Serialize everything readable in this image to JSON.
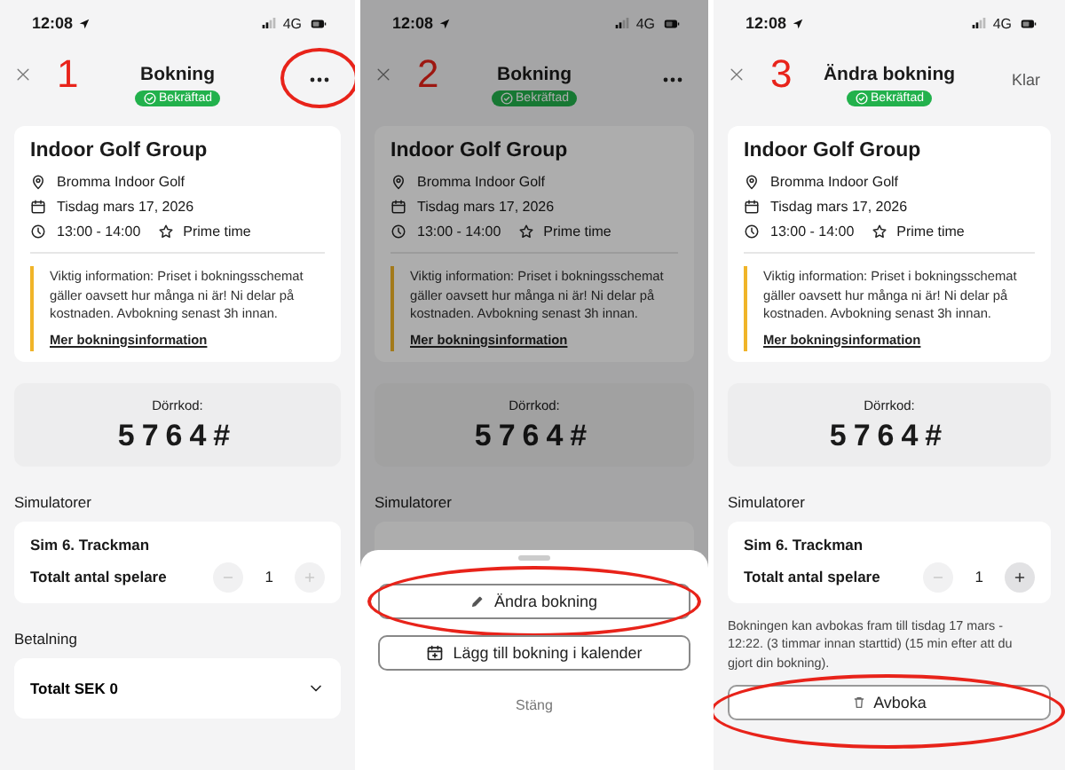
{
  "panels": [
    {
      "status_bar": {
        "time": "12:08",
        "network": "4G"
      },
      "step": "1",
      "dimmed": false,
      "header": {
        "title": "Bokning",
        "badge": "Bekräftad",
        "action": {
          "kind": "menu",
          "circled": true
        }
      },
      "booking": {
        "title": "Indoor Golf Group",
        "location": "Bromma Indoor Golf",
        "date": "Tisdag mars 17, 2026",
        "time": "13:00 - 14:00",
        "tag": "Prime time",
        "info": "Viktig information: Priset i bokningsschemat gäller oavsett hur många ni är! Ni delar på kostnaden. Avbokning senast 3h innan.",
        "link": "Mer bokningsinformation"
      },
      "door_code": {
        "label": "Dörrkod:",
        "code": "5764#"
      },
      "simulators": {
        "heading": "Simulatorer",
        "card": {
          "name": "Sim 6. Trackman",
          "players_label": "Totalt antal spelare",
          "count": "1",
          "minus_disabled": true,
          "plus_disabled": true
        }
      },
      "payment": {
        "heading": "Betalning",
        "total": "Totalt SEK 0",
        "expanded": false
      }
    },
    {
      "status_bar": {
        "time": "12:08",
        "network": "4G"
      },
      "step": "2",
      "dimmed": true,
      "header": {
        "title": "Bokning",
        "badge": "Bekräftad",
        "action": {
          "kind": "menu",
          "circled": false
        }
      },
      "booking": {
        "title": "Indoor Golf Group",
        "location": "Bromma Indoor Golf",
        "date": "Tisdag mars 17, 2026",
        "time": "13:00 - 14:00",
        "tag": "Prime time",
        "info": "Viktig information: Priset i bokningsschemat gäller oavsett hur många ni är! Ni delar på kostnaden. Avbokning senast 3h innan.",
        "link": "Mer bokningsinformation"
      },
      "door_code": {
        "label": "Dörrkod:",
        "code": "5764#"
      },
      "simulators": {
        "heading": "Simulatorer"
      },
      "sheet": {
        "actions": [
          {
            "kind": "edit",
            "label": "Ändra bokning",
            "circled": true
          },
          {
            "kind": "calendar",
            "label": "Lägg till bokning i kalender",
            "circled": false
          },
          {
            "kind": "close",
            "label": "Stäng",
            "circled": false
          }
        ]
      }
    },
    {
      "status_bar": {
        "time": "12:08",
        "network": "4G"
      },
      "step": "3",
      "dimmed": false,
      "header": {
        "title": "Ändra bokning",
        "badge": "Bekräftad",
        "action": {
          "kind": "text",
          "label": "Klar",
          "circled": false
        }
      },
      "booking": {
        "title": "Indoor Golf Group",
        "location": "Bromma Indoor Golf",
        "date": "Tisdag mars 17, 2026",
        "time": "13:00 - 14:00",
        "tag": "Prime time",
        "info": "Viktig information: Priset i bokningsschemat gäller oavsett hur många ni är! Ni delar på kostnaden. Avbokning senast 3h innan.",
        "link": "Mer bokningsinformation"
      },
      "door_code": {
        "label": "Dörrkod:",
        "code": "5764#"
      },
      "simulators": {
        "heading": "Simulatorer",
        "card": {
          "name": "Sim 6. Trackman",
          "players_label": "Totalt antal spelare",
          "count": "1",
          "minus_disabled": true,
          "plus_disabled": false
        }
      },
      "cancel": {
        "note": "Bokningen kan avbokas fram till tisdag 17 mars - 12:22. (3 timmar innan starttid) (15 min efter att du gjort din bokning).",
        "button": {
          "label": "Avboka",
          "circled": true
        }
      }
    }
  ]
}
